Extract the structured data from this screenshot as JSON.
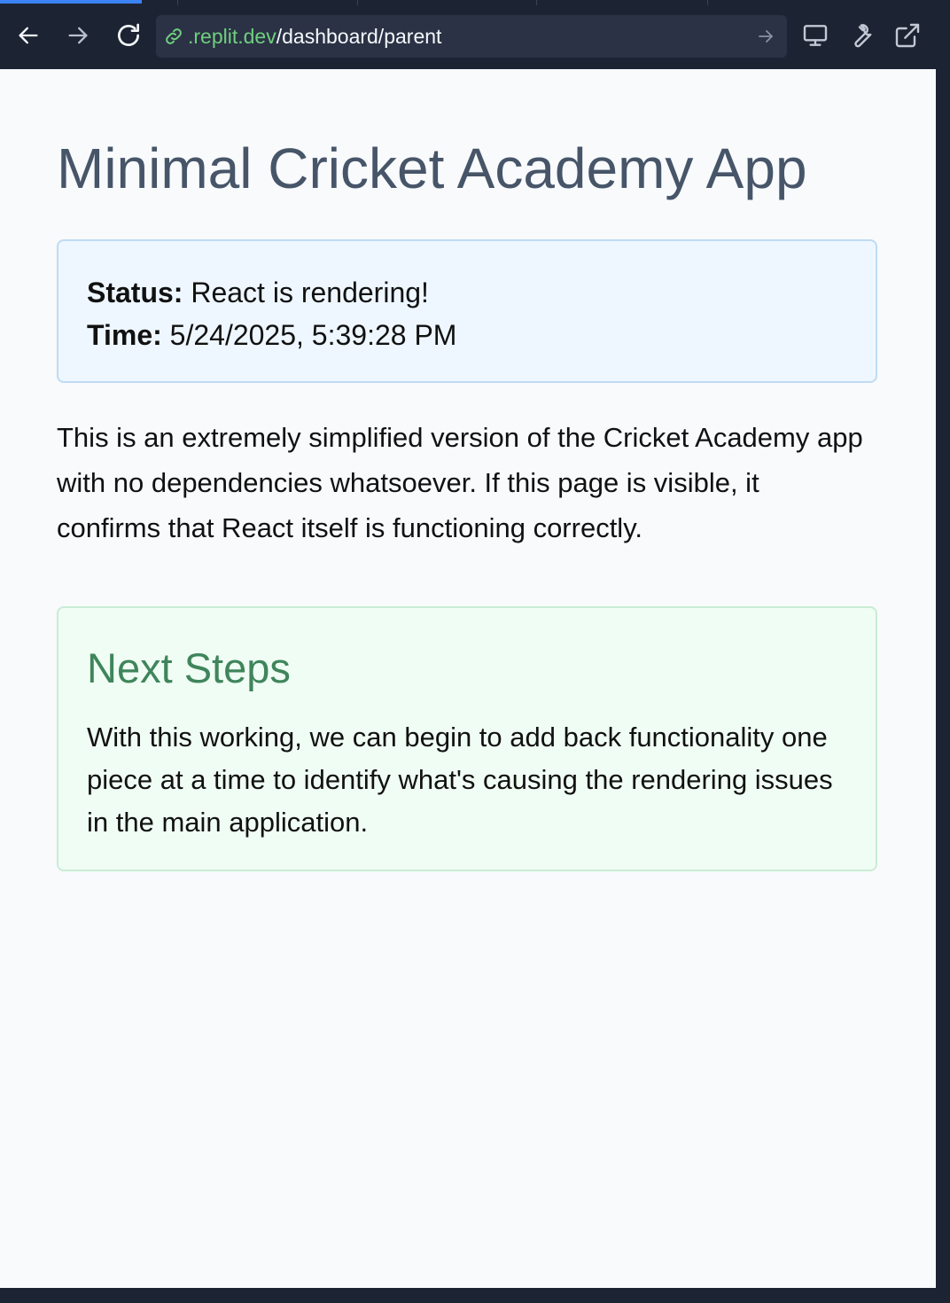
{
  "browser": {
    "url": {
      "domain": ".replit.dev",
      "path": "/dashboard/parent"
    },
    "icons": {
      "back": "arrow-left-icon",
      "forward": "arrow-right-icon",
      "reload": "reload-icon",
      "link": "link-icon",
      "go": "arrow-right-icon",
      "device": "monitor-icon",
      "devtools": "wrench-icon",
      "open_external": "external-link-icon"
    }
  },
  "page": {
    "title": "Minimal Cricket Academy App",
    "status_label": "Status:",
    "status_value": "React is rendering!",
    "time_label": "Time:",
    "time_value": "5/24/2025, 5:39:28 PM",
    "intro": "This is an extremely simplified version of the Cricket Academy app with no dependencies whatsoever. If this page is visible, it confirms that React itself is functioning correctly.",
    "next_steps": {
      "title": "Next Steps",
      "text": "With this working, we can begin to add back functionality one piece at a time to identify what's causing the rendering issues in the main application."
    }
  },
  "colors": {
    "chrome_bg": "#1c2333",
    "urlbar_bg": "#2b3245",
    "url_domain": "#6fcf7e",
    "tab_active": "#3b82f6",
    "page_bg": "#f8fafc",
    "title_text": "#475569",
    "status_box_bg": "#eef7ff",
    "status_box_border": "#bfdbf2",
    "steps_box_bg": "#f0fdf4",
    "steps_box_border": "#c9ecd5",
    "steps_title": "#3f855b"
  }
}
